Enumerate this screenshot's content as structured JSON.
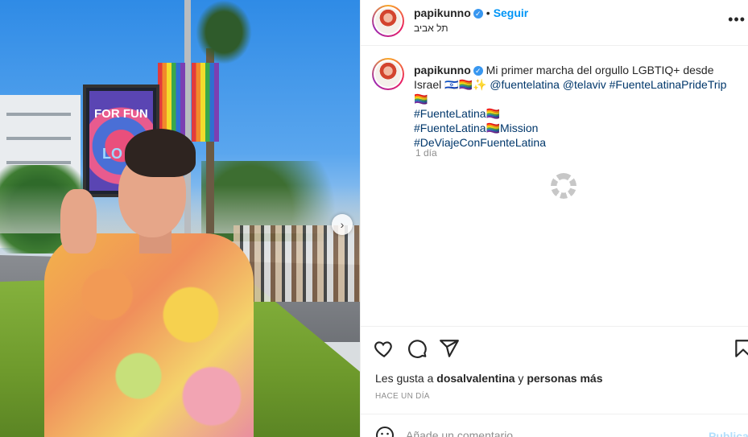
{
  "post": {
    "author": "papikunno",
    "follow_label": "Seguir",
    "separator": "•",
    "location": "תל אביב",
    "more_label": "•••"
  },
  "caption": {
    "author": "papikunno",
    "text_start": "Mi primer marcha del orgullo LGBTIQ+ desde Israel ",
    "flag_il": "🇮🇱",
    "emoji_flags": "🏳️‍🌈✨",
    "mention1": "@fuentelatina",
    "mention2": "@telaviv",
    "hashtag1": "#FuenteLatinaPrideTrip",
    "hashtag2": "#FuenteLatina",
    "hashtag3": "#FuenteLatina",
    "mission": "Mission",
    "hashtag4": "#DeViajeConFuenteLatina",
    "rainbow": "🏳️‍🌈",
    "time_ago": "1 día"
  },
  "photo": {
    "billboard_text1": "FOR FUN",
    "billboard_text2": "LO",
    "next_icon": "›"
  },
  "actions": {
    "like_icon": "heart-icon",
    "comment_icon": "comment-icon",
    "share_icon": "share-icon",
    "save_icon": "bookmark-icon"
  },
  "likes": {
    "prefix": "Les gusta a ",
    "user": "dosalvalentina",
    "middle": " y ",
    "others": "personas más"
  },
  "date_label": "HACE UN DÍA",
  "comment": {
    "placeholder": "Añade un comentario...",
    "publish_label": "Publicar"
  },
  "colors": {
    "link": "#00376b",
    "follow": "#0095f6",
    "verified": "#3897f0"
  }
}
